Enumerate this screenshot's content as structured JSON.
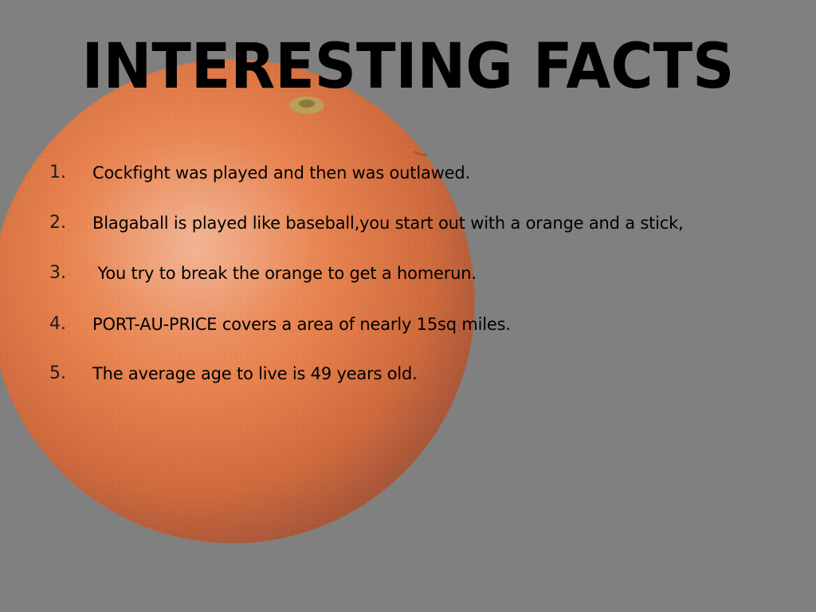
{
  "slide": {
    "title": "INTERESTING FACTS",
    "background_color": "#808080",
    "accent_color": "#e8794f",
    "background_image": "orange-fruit-photo",
    "facts": [
      {
        "number": "1.",
        "text": "Cockfight was played and then was outlawed."
      },
      {
        "number": "2.",
        "text": "Blagaball is played like baseball,you start out with a orange and a stick,"
      },
      {
        "number": "3.",
        "text": " You try to break the orange to get a homerun."
      },
      {
        "number": "4.",
        "text": "PORT-AU-PRICE covers a area of nearly 15sq miles."
      },
      {
        "number": "5.",
        "text": "The average age to live is 49 years old."
      }
    ]
  }
}
